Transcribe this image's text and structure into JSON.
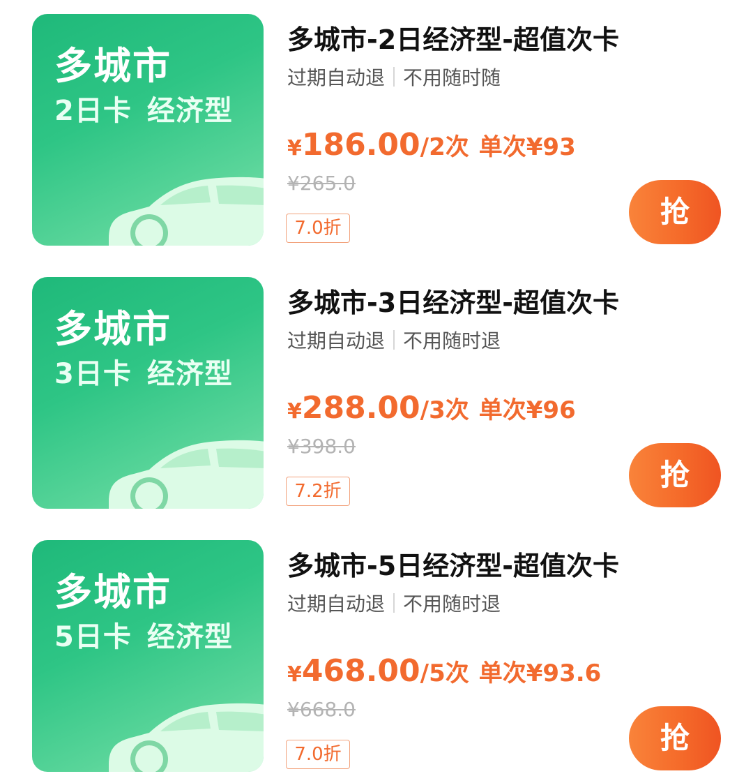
{
  "cards": [
    {
      "thumb_title": "多城市",
      "thumb_days": "2日卡",
      "thumb_type": "经济型",
      "title": "多城市-2日经济型-超值次卡",
      "tag1": "过期自动退",
      "tag2": "不用随时随",
      "currency": "¥",
      "price": "186.00",
      "count": "/2次",
      "unit_price": "单次¥93",
      "original_price": "¥265.0",
      "discount": "7.0折",
      "button": "抢"
    },
    {
      "thumb_title": "多城市",
      "thumb_days": "3日卡",
      "thumb_type": "经济型",
      "title": "多城市-3日经济型-超值次卡",
      "tag1": "过期自动退",
      "tag2": "不用随时退",
      "currency": "¥",
      "price": "288.00",
      "count": "/3次",
      "unit_price": "单次¥96",
      "original_price": "¥398.0",
      "discount": "7.2折",
      "button": "抢"
    },
    {
      "thumb_title": "多城市",
      "thumb_days": "5日卡",
      "thumb_type": "经济型",
      "title": "多城市-5日经济型-超值次卡",
      "tag1": "过期自动退",
      "tag2": "不用随时退",
      "currency": "¥",
      "price": "468.00",
      "count": "/5次",
      "unit_price": "单次¥93.6",
      "original_price": "¥668.0",
      "discount": "7.0折",
      "button": "抢"
    }
  ],
  "colors": {
    "accent": "#f26a2e",
    "thumb_green": "#2ec585",
    "button_gradient_start": "#f9833a",
    "button_gradient_end": "#ef5422"
  }
}
